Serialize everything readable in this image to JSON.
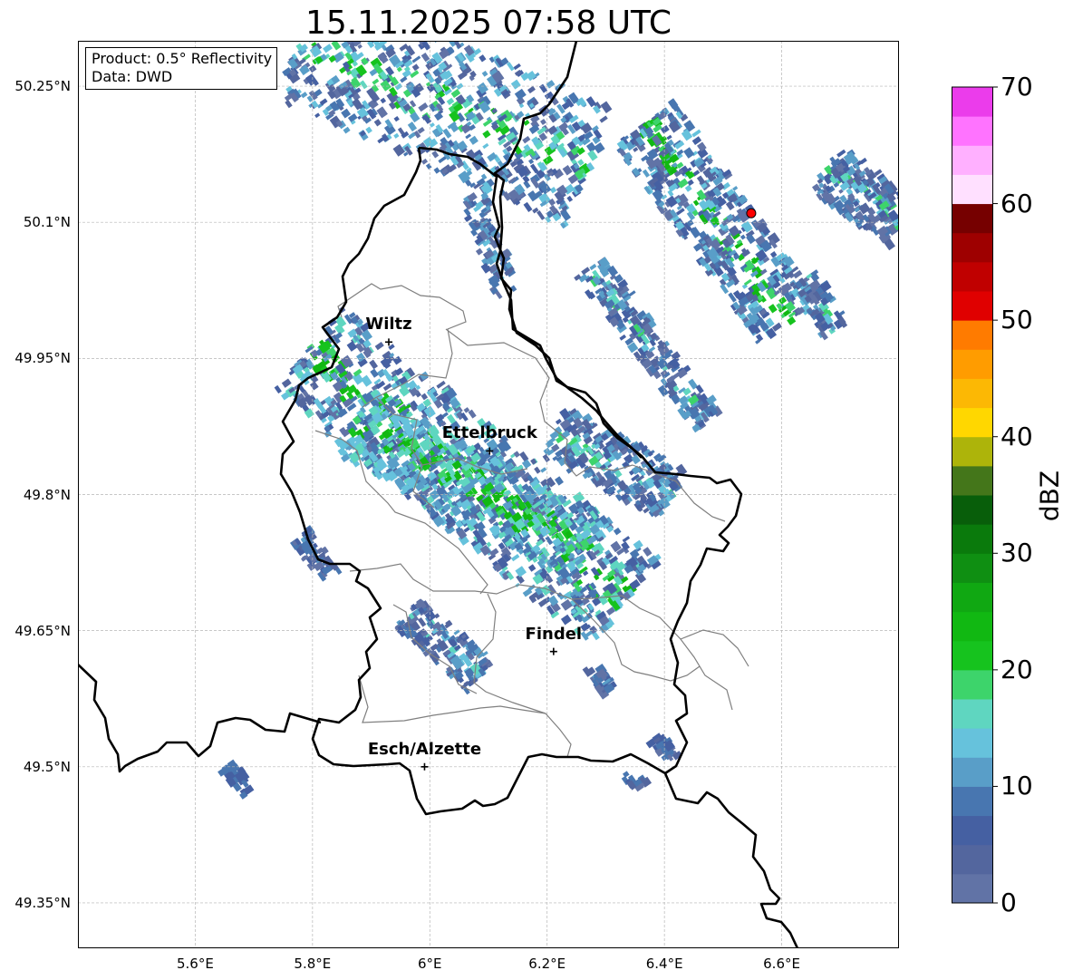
{
  "title": "15.11.2025 07:58 UTC",
  "info": {
    "product": "Product: 0.5° Reflectivity",
    "source": "Data: DWD"
  },
  "map": {
    "lon_range": [
      5.4,
      6.8
    ],
    "lat_range": [
      49.3,
      50.3
    ],
    "lat_ticks": [
      {
        "value": 50.25,
        "label": "50.25°N"
      },
      {
        "value": 50.1,
        "label": "50.1°N"
      },
      {
        "value": 49.95,
        "label": "49.95°N"
      },
      {
        "value": 49.8,
        "label": "49.8°N"
      },
      {
        "value": 49.65,
        "label": "49.65°N"
      },
      {
        "value": 49.5,
        "label": "49.5°N"
      },
      {
        "value": 49.35,
        "label": "49.35°N"
      }
    ],
    "lon_ticks": [
      {
        "value": 5.6,
        "label": "5.6°E"
      },
      {
        "value": 5.8,
        "label": "5.8°E"
      },
      {
        "value": 6.0,
        "label": "6°E"
      },
      {
        "value": 6.2,
        "label": "6.2°E"
      },
      {
        "value": 6.4,
        "label": "6.4°E"
      },
      {
        "value": 6.6,
        "label": "6.6°E"
      }
    ],
    "cities": [
      {
        "name": "Wiltz",
        "lon": 5.93,
        "lat": 49.968
      },
      {
        "name": "Ettelbruck",
        "lon": 6.102,
        "lat": 49.848
      },
      {
        "name": "Findel",
        "lon": 6.211,
        "lat": 49.627
      },
      {
        "name": "Esch/Alzette",
        "lon": 5.991,
        "lat": 49.5
      }
    ],
    "radar_site": {
      "lon": 6.548,
      "lat": 50.11,
      "color": "#ff0000"
    }
  },
  "colorbar": {
    "label": "dBZ",
    "min": 0,
    "max": 70,
    "step": 2.5,
    "ticks": [
      "0",
      "10",
      "20",
      "30",
      "40",
      "50",
      "60",
      "70"
    ],
    "colors": [
      "#6173a6",
      "#53669e",
      "#4560a2",
      "#4876b0",
      "#599ec8",
      "#66c2dc",
      "#5fd6c0",
      "#3dd46b",
      "#16c31e",
      "#11b812",
      "#10a812",
      "#0f8f12",
      "#0a7a0c",
      "#085e0a",
      "#44761a",
      "#adb40a",
      "#ffd700",
      "#fcb804",
      "#ff9c00",
      "#ff7b00",
      "#e00000",
      "#c00000",
      "#9e0000",
      "#760000",
      "#ffe0ff",
      "#ffb0ff",
      "#ff73ff",
      "#eb3ceb"
    ]
  },
  "colors": {
    "border": "#000000",
    "canton_lines": "#7f7f7f",
    "grid": "#b5b5b5"
  }
}
